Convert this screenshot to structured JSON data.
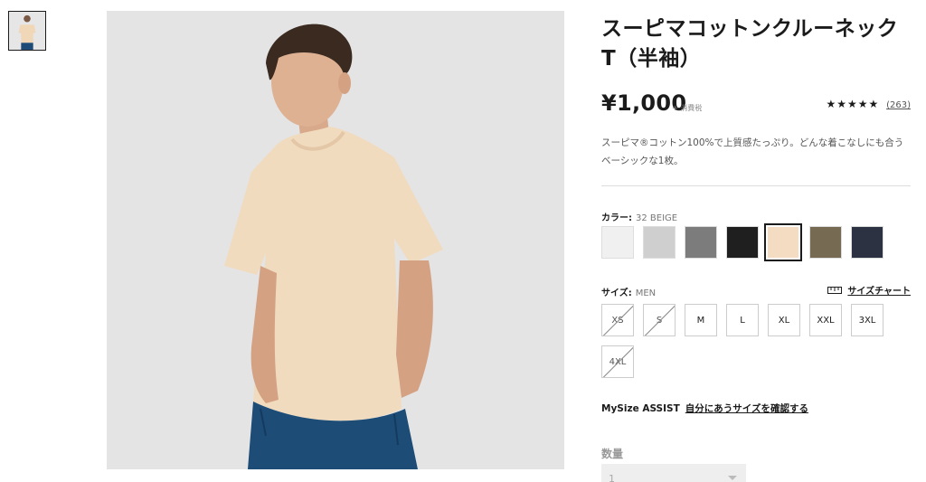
{
  "thumbnail": {
    "icon": "product-thumbnail-image"
  },
  "main_image": {
    "icon": "model-wearing-beige-tshirt-image"
  },
  "product": {
    "title": "スーピマコットンクルーネックT（半袖）",
    "price": "¥1,000",
    "tax_note": "+ 消費税",
    "stars": "★★★★★",
    "rating": 4.5,
    "review_count": "(263)",
    "description": "スーピマ®コットン100%で上質感たっぷり。どんな着こなしにも合うベーシックな1枚。"
  },
  "color": {
    "label": "カラー:",
    "selected": "32 BEIGE",
    "swatches": [
      {
        "name": "off-white",
        "hex": "#f0f0f0"
      },
      {
        "name": "light-gray",
        "hex": "#cfcfcf"
      },
      {
        "name": "gray",
        "hex": "#7c7c7c"
      },
      {
        "name": "black",
        "hex": "#1f1f1f"
      },
      {
        "name": "beige",
        "hex": "#f3dcc1"
      },
      {
        "name": "olive",
        "hex": "#766b52"
      },
      {
        "name": "navy",
        "hex": "#2c3242"
      }
    ]
  },
  "size": {
    "label": "サイズ:",
    "value": "MEN",
    "chart_link": "サイズチャート",
    "options": [
      {
        "label": "XS",
        "available": false
      },
      {
        "label": "S",
        "available": false
      },
      {
        "label": "M",
        "available": true
      },
      {
        "label": "L",
        "available": true
      },
      {
        "label": "XL",
        "available": true
      },
      {
        "label": "XXL",
        "available": true
      },
      {
        "label": "3XL",
        "available": true
      },
      {
        "label": "4XL",
        "available": false
      }
    ]
  },
  "mysize": {
    "label": "MySize ASSIST",
    "link": "自分にあうサイズを確認する"
  },
  "quantity": {
    "label": "数量",
    "value": "1"
  },
  "colors": {
    "text": "#1b1b1b",
    "muted": "#777777",
    "border": "#dddddd"
  }
}
